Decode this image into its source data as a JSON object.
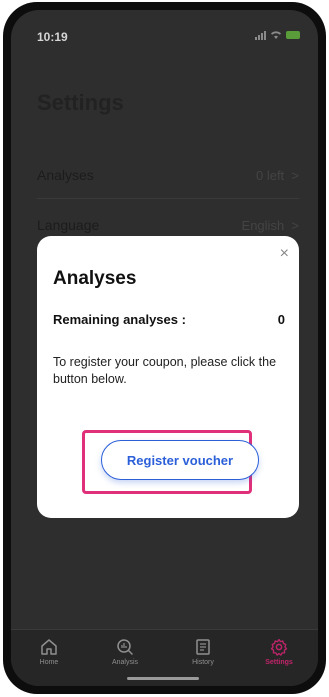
{
  "status_bar": {
    "time": "10:19"
  },
  "page": {
    "title": "Settings"
  },
  "settings_rows": [
    {
      "label": "Analyses",
      "value": "0 left",
      "chevron": ">"
    },
    {
      "label": "Language",
      "value": "English",
      "chevron": ">"
    }
  ],
  "modal": {
    "close_label": "×",
    "title": "Analyses",
    "remaining_label": "Remaining analyses :",
    "remaining_value": "0",
    "description": "To register your coupon, please click the button below.",
    "register_button": "Register voucher"
  },
  "tabs": [
    {
      "label": "Home",
      "icon": "home-icon"
    },
    {
      "label": "Analysis",
      "icon": "search-chart-icon"
    },
    {
      "label": "History",
      "icon": "document-icon"
    },
    {
      "label": "Settings",
      "icon": "gear-icon",
      "active": true
    }
  ],
  "colors": {
    "accent": "#2b5fd9",
    "highlight": "#e0307a",
    "active_tab": "#c0246a"
  }
}
